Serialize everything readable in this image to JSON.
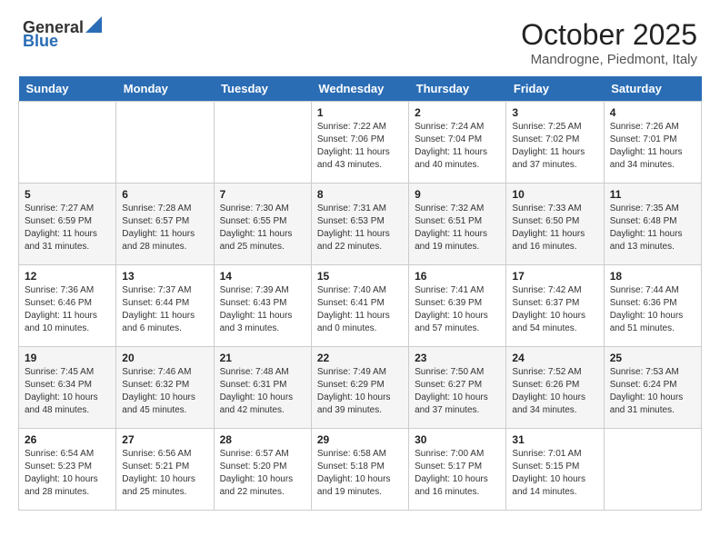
{
  "header": {
    "logo_general": "General",
    "logo_blue": "Blue",
    "month": "October 2025",
    "location": "Mandrogne, Piedmont, Italy"
  },
  "days_of_week": [
    "Sunday",
    "Monday",
    "Tuesday",
    "Wednesday",
    "Thursday",
    "Friday",
    "Saturday"
  ],
  "weeks": [
    [
      {
        "day": "",
        "content": ""
      },
      {
        "day": "",
        "content": ""
      },
      {
        "day": "",
        "content": ""
      },
      {
        "day": "1",
        "content": "Sunrise: 7:22 AM\nSunset: 7:06 PM\nDaylight: 11 hours\nand 43 minutes."
      },
      {
        "day": "2",
        "content": "Sunrise: 7:24 AM\nSunset: 7:04 PM\nDaylight: 11 hours\nand 40 minutes."
      },
      {
        "day": "3",
        "content": "Sunrise: 7:25 AM\nSunset: 7:02 PM\nDaylight: 11 hours\nand 37 minutes."
      },
      {
        "day": "4",
        "content": "Sunrise: 7:26 AM\nSunset: 7:01 PM\nDaylight: 11 hours\nand 34 minutes."
      }
    ],
    [
      {
        "day": "5",
        "content": "Sunrise: 7:27 AM\nSunset: 6:59 PM\nDaylight: 11 hours\nand 31 minutes."
      },
      {
        "day": "6",
        "content": "Sunrise: 7:28 AM\nSunset: 6:57 PM\nDaylight: 11 hours\nand 28 minutes."
      },
      {
        "day": "7",
        "content": "Sunrise: 7:30 AM\nSunset: 6:55 PM\nDaylight: 11 hours\nand 25 minutes."
      },
      {
        "day": "8",
        "content": "Sunrise: 7:31 AM\nSunset: 6:53 PM\nDaylight: 11 hours\nand 22 minutes."
      },
      {
        "day": "9",
        "content": "Sunrise: 7:32 AM\nSunset: 6:51 PM\nDaylight: 11 hours\nand 19 minutes."
      },
      {
        "day": "10",
        "content": "Sunrise: 7:33 AM\nSunset: 6:50 PM\nDaylight: 11 hours\nand 16 minutes."
      },
      {
        "day": "11",
        "content": "Sunrise: 7:35 AM\nSunset: 6:48 PM\nDaylight: 11 hours\nand 13 minutes."
      }
    ],
    [
      {
        "day": "12",
        "content": "Sunrise: 7:36 AM\nSunset: 6:46 PM\nDaylight: 11 hours\nand 10 minutes."
      },
      {
        "day": "13",
        "content": "Sunrise: 7:37 AM\nSunset: 6:44 PM\nDaylight: 11 hours\nand 6 minutes."
      },
      {
        "day": "14",
        "content": "Sunrise: 7:39 AM\nSunset: 6:43 PM\nDaylight: 11 hours\nand 3 minutes."
      },
      {
        "day": "15",
        "content": "Sunrise: 7:40 AM\nSunset: 6:41 PM\nDaylight: 11 hours\nand 0 minutes."
      },
      {
        "day": "16",
        "content": "Sunrise: 7:41 AM\nSunset: 6:39 PM\nDaylight: 10 hours\nand 57 minutes."
      },
      {
        "day": "17",
        "content": "Sunrise: 7:42 AM\nSunset: 6:37 PM\nDaylight: 10 hours\nand 54 minutes."
      },
      {
        "day": "18",
        "content": "Sunrise: 7:44 AM\nSunset: 6:36 PM\nDaylight: 10 hours\nand 51 minutes."
      }
    ],
    [
      {
        "day": "19",
        "content": "Sunrise: 7:45 AM\nSunset: 6:34 PM\nDaylight: 10 hours\nand 48 minutes."
      },
      {
        "day": "20",
        "content": "Sunrise: 7:46 AM\nSunset: 6:32 PM\nDaylight: 10 hours\nand 45 minutes."
      },
      {
        "day": "21",
        "content": "Sunrise: 7:48 AM\nSunset: 6:31 PM\nDaylight: 10 hours\nand 42 minutes."
      },
      {
        "day": "22",
        "content": "Sunrise: 7:49 AM\nSunset: 6:29 PM\nDaylight: 10 hours\nand 39 minutes."
      },
      {
        "day": "23",
        "content": "Sunrise: 7:50 AM\nSunset: 6:27 PM\nDaylight: 10 hours\nand 37 minutes."
      },
      {
        "day": "24",
        "content": "Sunrise: 7:52 AM\nSunset: 6:26 PM\nDaylight: 10 hours\nand 34 minutes."
      },
      {
        "day": "25",
        "content": "Sunrise: 7:53 AM\nSunset: 6:24 PM\nDaylight: 10 hours\nand 31 minutes."
      }
    ],
    [
      {
        "day": "26",
        "content": "Sunrise: 6:54 AM\nSunset: 5:23 PM\nDaylight: 10 hours\nand 28 minutes."
      },
      {
        "day": "27",
        "content": "Sunrise: 6:56 AM\nSunset: 5:21 PM\nDaylight: 10 hours\nand 25 minutes."
      },
      {
        "day": "28",
        "content": "Sunrise: 6:57 AM\nSunset: 5:20 PM\nDaylight: 10 hours\nand 22 minutes."
      },
      {
        "day": "29",
        "content": "Sunrise: 6:58 AM\nSunset: 5:18 PM\nDaylight: 10 hours\nand 19 minutes."
      },
      {
        "day": "30",
        "content": "Sunrise: 7:00 AM\nSunset: 5:17 PM\nDaylight: 10 hours\nand 16 minutes."
      },
      {
        "day": "31",
        "content": "Sunrise: 7:01 AM\nSunset: 5:15 PM\nDaylight: 10 hours\nand 14 minutes."
      },
      {
        "day": "",
        "content": ""
      }
    ]
  ]
}
